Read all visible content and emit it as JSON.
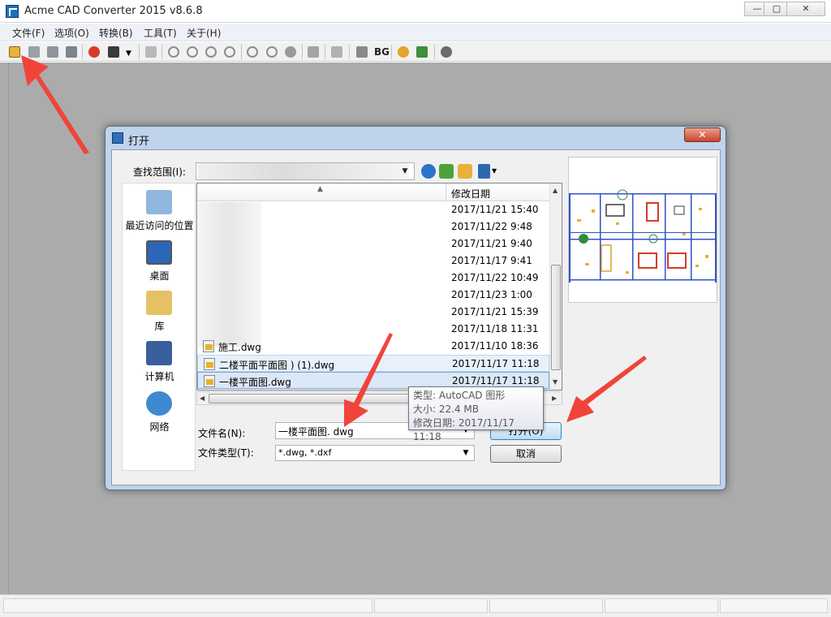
{
  "app": {
    "title": "Acme CAD Converter 2015 v8.6.8",
    "minimize": "—",
    "maximize": "▢",
    "close": "✕"
  },
  "menu": [
    {
      "label": "文件(F)"
    },
    {
      "label": "选项(O)"
    },
    {
      "label": "转换(B)"
    },
    {
      "label": "工具(T)"
    },
    {
      "label": "关于(H)"
    }
  ],
  "toolbar": {
    "bg_label": "BG",
    "icons": [
      "open-folder-icon",
      "save-icon",
      "save-as-icon",
      "batch-convert-icon",
      "pdf-icon",
      "export-icon",
      "print-icon",
      "zoom-out-icon",
      "zoom-in-icon",
      "zoom-window-icon",
      "zoom-extents-icon",
      "zoom-previous-icon",
      "zoom-realtime-icon",
      "pan-icon",
      "layers-icon",
      "background-icon",
      "help-icon",
      "home-icon",
      "about-icon"
    ]
  },
  "dialog": {
    "title": "打开",
    "close": "✕",
    "lookin_label": "查找范围(I):",
    "places": [
      {
        "label": "最近访问的位置",
        "icon": "recent-places-icon"
      },
      {
        "label": "桌面",
        "icon": "desktop-icon"
      },
      {
        "label": "库",
        "icon": "libraries-icon"
      },
      {
        "label": "计算机",
        "icon": "computer-icon"
      },
      {
        "label": "网络",
        "icon": "network-icon"
      }
    ],
    "column_date": "修改日期",
    "files": [
      {
        "name": "",
        "date": "2017/11/21 15:40"
      },
      {
        "name": "",
        "date": "2017/11/22 9:48"
      },
      {
        "name": "",
        "date": "2017/11/21 9:40"
      },
      {
        "name": "",
        "date": "2017/11/17 9:41"
      },
      {
        "name": "",
        "date": "2017/11/22 10:49"
      },
      {
        "name": "",
        "date": "2017/11/23 1:00"
      },
      {
        "name": "",
        "date": "2017/11/21 15:39"
      },
      {
        "name": "",
        "date": "2017/11/18 11:31"
      },
      {
        "name": "施工.dwg",
        "date": "2017/11/10 18:36"
      },
      {
        "name": "二楼平面平面图 ) (1).dwg",
        "date": "2017/11/17 11:18"
      },
      {
        "name": "一楼平面图.dwg",
        "date": "2017/11/17 11:18"
      }
    ],
    "filename_label": "文件名(N):",
    "filename_value": "一楼平面图. dwg",
    "filetype_label": "文件类型(T):",
    "filetype_value": "*.dwg, *.dxf",
    "open_button": "打开(O)",
    "cancel_button": "取消"
  },
  "tooltip": {
    "type": "类型: AutoCAD 图形",
    "size": "大小: 22.4 MB",
    "modified": "修改日期: 2017/11/17 11:18"
  },
  "colors": {
    "arrow": "#f0443a",
    "dialog_frame": "#bfd3ea",
    "workspace": "#ababab"
  }
}
